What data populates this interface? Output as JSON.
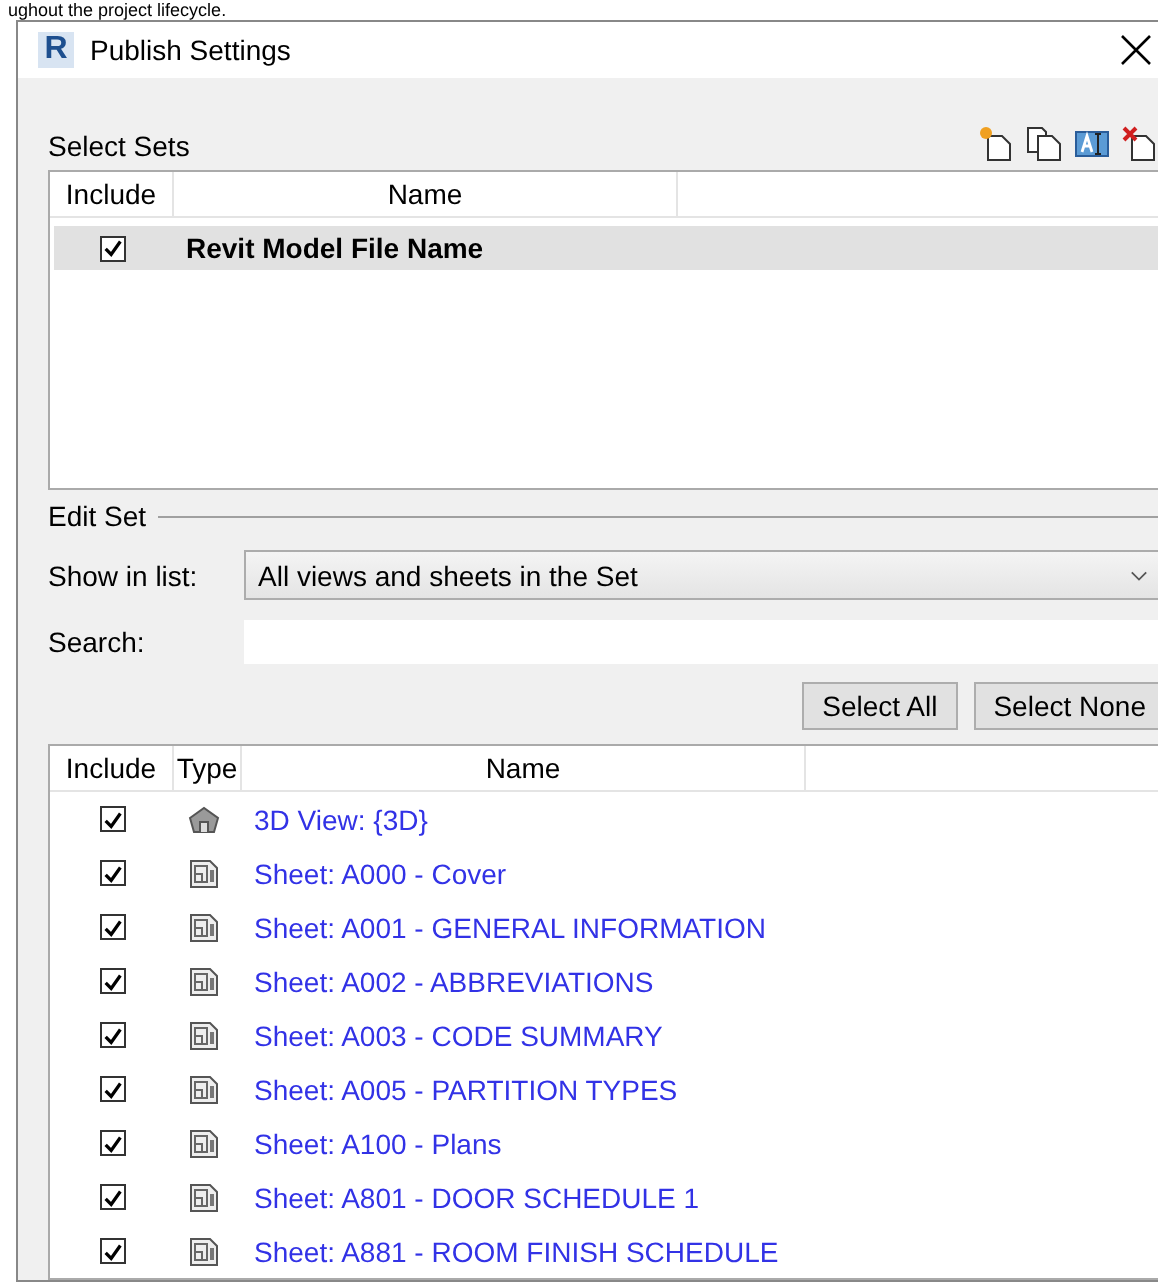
{
  "page_text": "ughout the project lifecycle.",
  "window": {
    "logo": "R",
    "title": "Publish Settings"
  },
  "select_sets": {
    "label": "Select Sets",
    "columns": [
      "Include",
      "Name"
    ],
    "rows": [
      {
        "include": true,
        "name": "Revit Model File Name",
        "selected": true
      }
    ]
  },
  "edit_set": {
    "label": "Edit Set",
    "show_in_list": {
      "label": "Show in list:",
      "value": "All views and sheets in the Set"
    },
    "search": {
      "label": "Search:"
    },
    "buttons": [
      "Select All",
      "Select None"
    ],
    "columns": [
      "Include",
      "Type",
      "Name"
    ],
    "rows": [
      {
        "include": true,
        "kind": "view",
        "name": "3D View: {3D}"
      },
      {
        "include": true,
        "kind": "sheet",
        "name": "Sheet: A000 - Cover"
      },
      {
        "include": true,
        "kind": "sheet",
        "name": "Sheet: A001 - GENERAL INFORMATION"
      },
      {
        "include": true,
        "kind": "sheet",
        "name": "Sheet: A002 - ABBREVIATIONS"
      },
      {
        "include": true,
        "kind": "sheet",
        "name": "Sheet: A003 - CODE SUMMARY"
      },
      {
        "include": true,
        "kind": "sheet",
        "name": "Sheet: A005 - PARTITION TYPES"
      },
      {
        "include": true,
        "kind": "sheet",
        "name": "Sheet: A100 - Plans"
      },
      {
        "include": true,
        "kind": "sheet",
        "name": "Sheet: A801 - DOOR SCHEDULE 1"
      },
      {
        "include": true,
        "kind": "sheet",
        "name": "Sheet: A881 - ROOM FINISH SCHEDULE"
      }
    ]
  }
}
